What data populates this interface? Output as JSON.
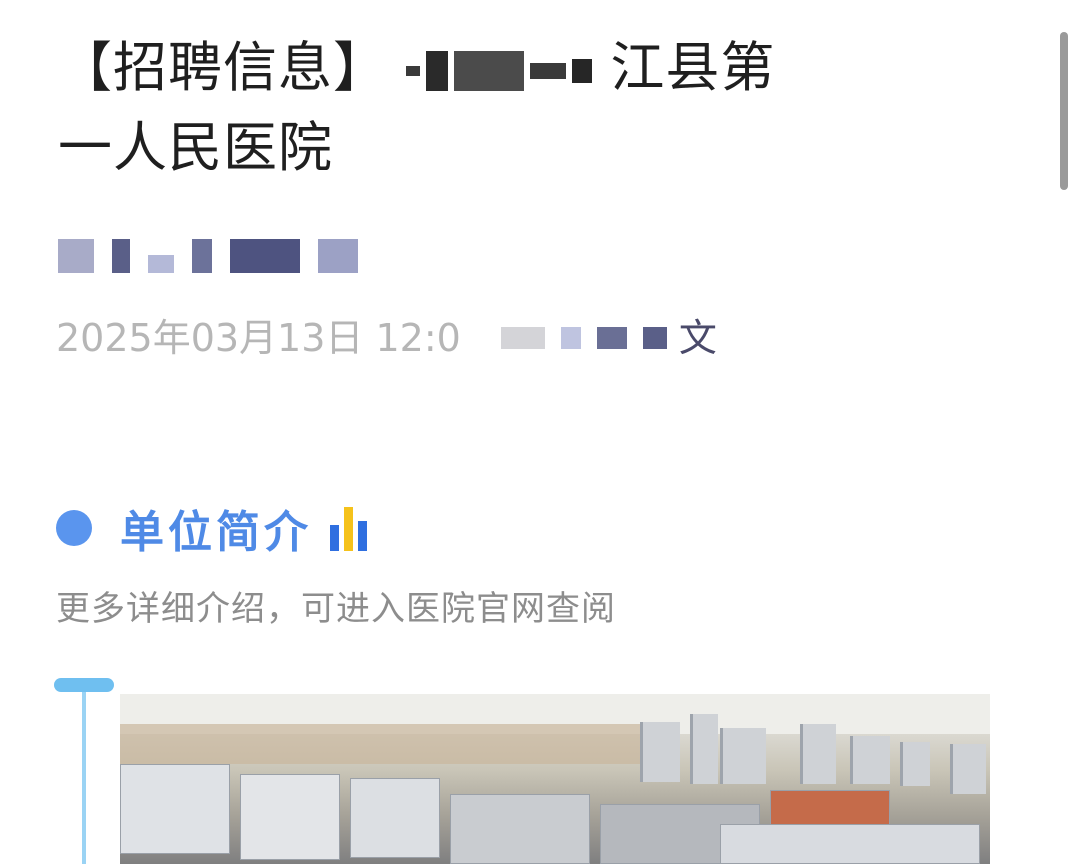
{
  "article": {
    "title_prefix": "【招聘信息】",
    "title_suffix": "江县第",
    "title_line2": "一人民医院",
    "meta_date": "2025年03月13日 12:0",
    "meta_tail": "文"
  },
  "section": {
    "title": "单位简介",
    "subtitle": "更多详细介绍，可进入医院官网查阅",
    "bar_colors": [
      "#2f6fe0",
      "#f5c21b",
      "#2f6fe0"
    ]
  },
  "colors": {
    "section_accent": "#4f8ae6",
    "dot": "#5a95ee",
    "timeline": "#6fbff0"
  }
}
